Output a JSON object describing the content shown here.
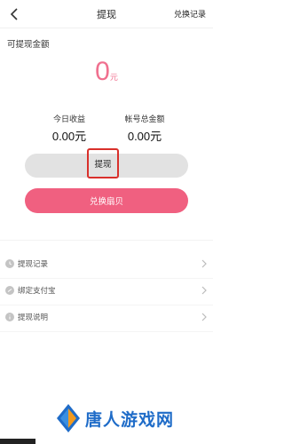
{
  "nav": {
    "title": "提现",
    "right_link": "兑换记录"
  },
  "balance": {
    "label": "可提现金额",
    "amount": "0",
    "unit": "元"
  },
  "stats": {
    "today_label": "今日收益",
    "today_value": "0.00元",
    "total_label": "帐号总金额",
    "total_value": "0.00元"
  },
  "buttons": {
    "withdraw": "提现",
    "exchange": "兑换扇贝"
  },
  "menu": [
    {
      "label": "提现记录"
    },
    {
      "label": "绑定支付宝"
    },
    {
      "label": "提现说明"
    }
  ],
  "watermark": {
    "text": "唐人游戏网"
  },
  "colors": {
    "accent": "#f06080",
    "amount": "#f0708f",
    "highlight_box": "#d9302b",
    "watermark": "#1f6cc8"
  }
}
